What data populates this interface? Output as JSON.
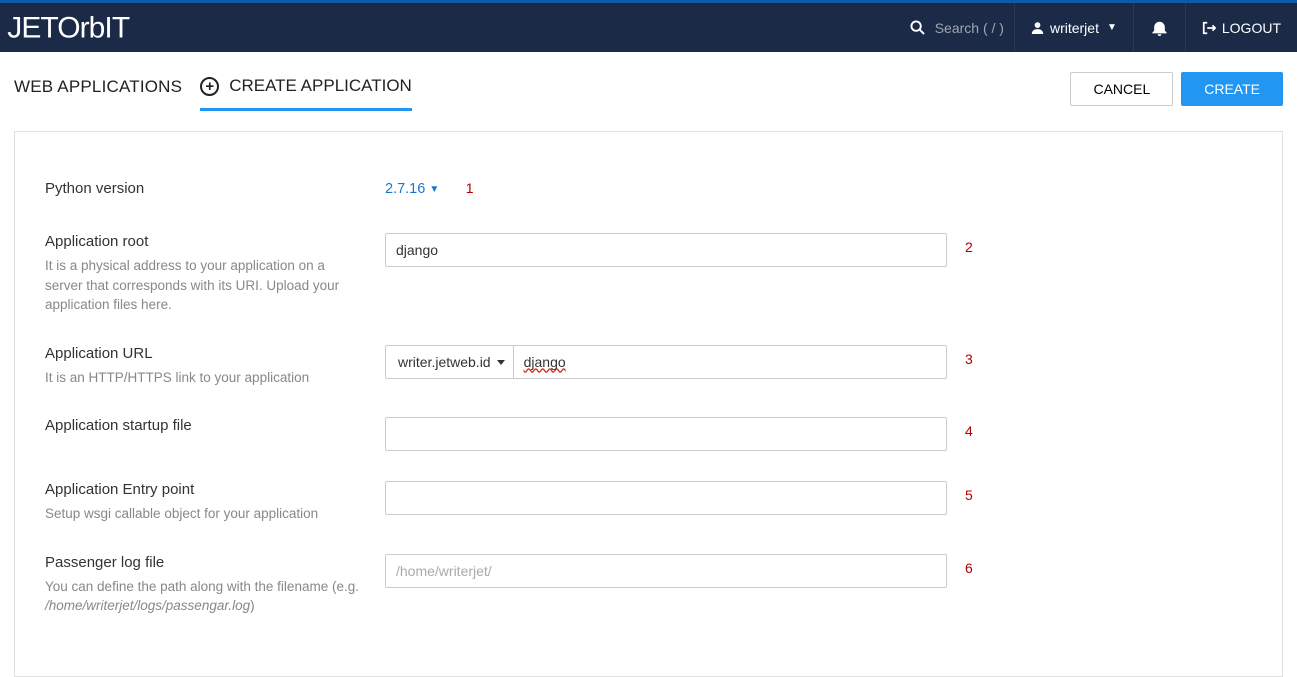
{
  "navbar": {
    "logo_text": "JETORBIT",
    "search_placeholder": "Search ( / )",
    "username": "writerjet",
    "logout": "LOGOUT"
  },
  "header": {
    "breadcrumb": "WEB APPLICATIONS",
    "tab_label": "CREATE APPLICATION",
    "cancel": "CANCEL",
    "create": "CREATE"
  },
  "form": {
    "python_version": {
      "label": "Python version",
      "value": "2.7.16",
      "annot": "1"
    },
    "app_root": {
      "label": "Application root",
      "hint": "It is a physical address to your application on a server that corresponds with its URI. Upload your application files here.",
      "value": "django",
      "annot": "2"
    },
    "app_url": {
      "label": "Application URL",
      "hint": "It is an HTTP/HTTPS link to your application",
      "domain": "writer.jetweb.id",
      "value": "django",
      "annot": "3"
    },
    "startup": {
      "label": "Application startup file",
      "value": "",
      "annot": "4"
    },
    "entry": {
      "label": "Application Entry point",
      "hint": "Setup wsgi callable object for your application",
      "value": "",
      "annot": "5"
    },
    "logfile": {
      "label": "Passenger log file",
      "hint_pre": "You can define the path along with the filename (e.g.",
      "hint_italic": "/home/writerjet/logs/passengar.log",
      "hint_post": ")",
      "placeholder": "/home/writerjet/",
      "value": "",
      "annot": "6"
    }
  }
}
